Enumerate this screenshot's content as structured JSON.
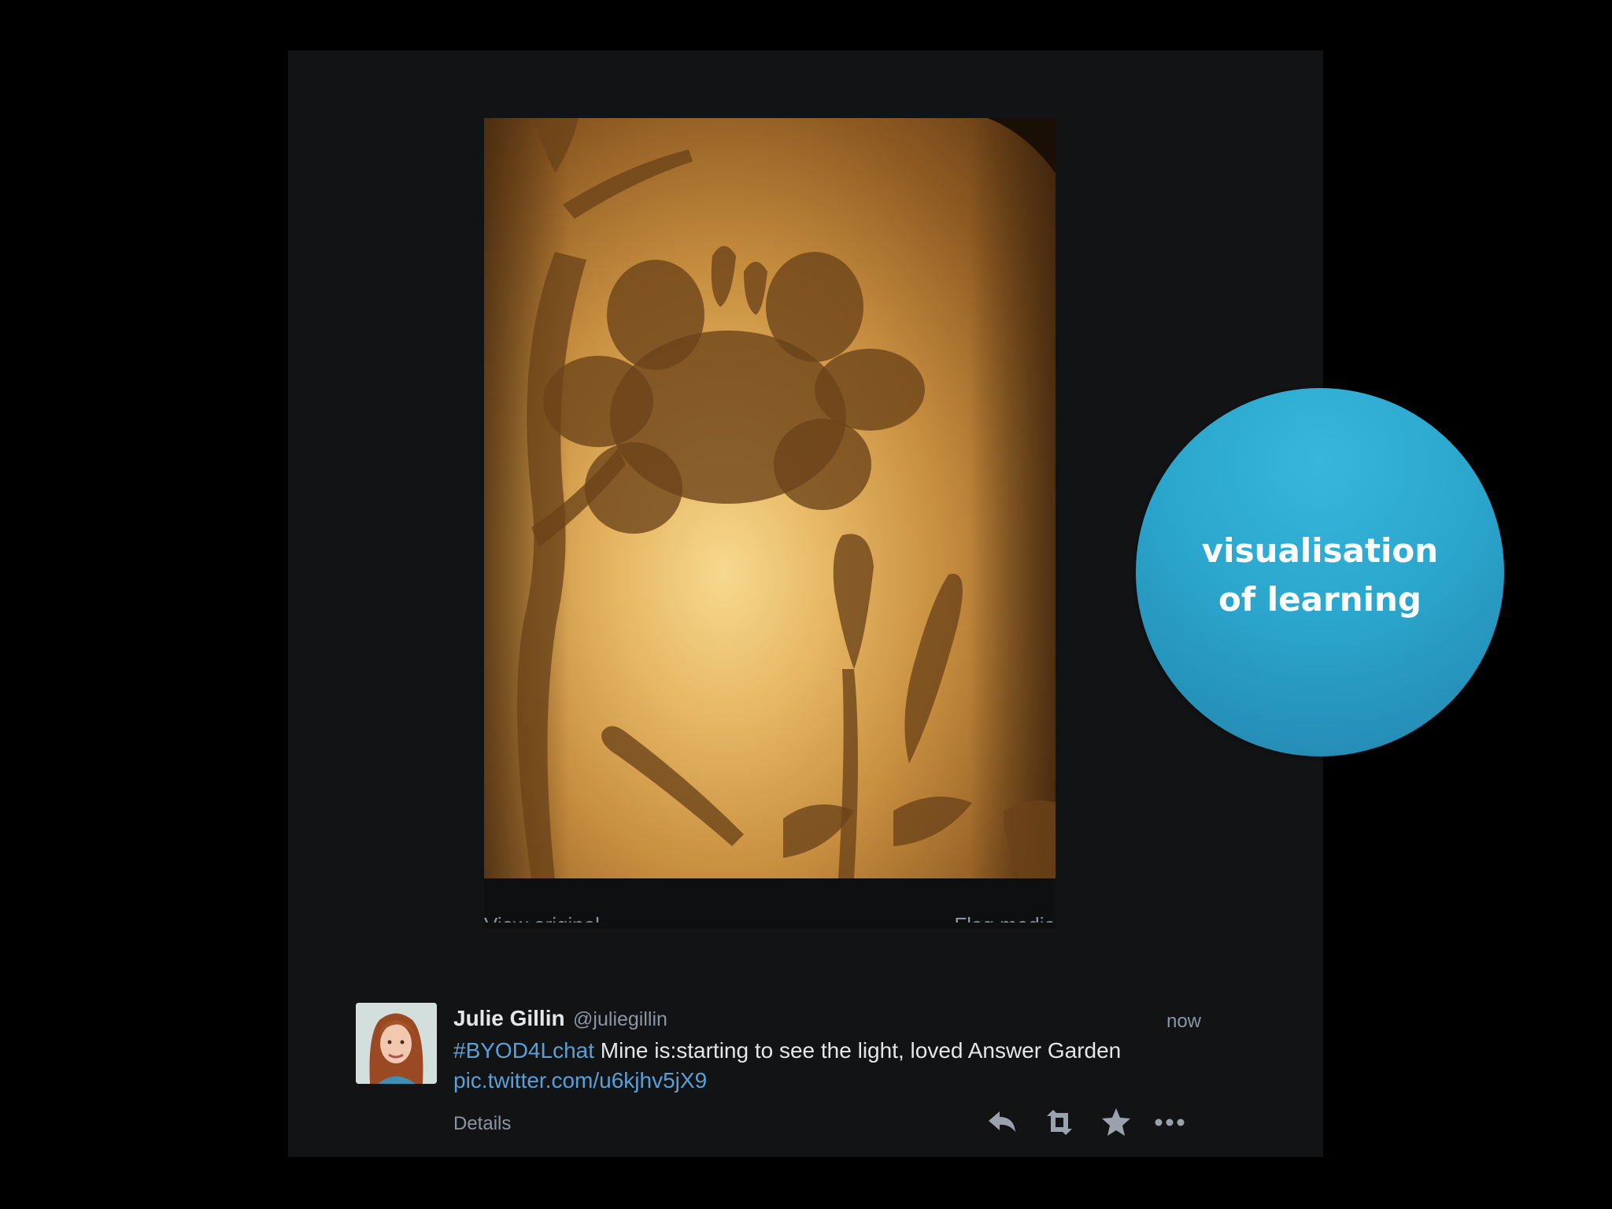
{
  "media": {
    "view_original": "View original",
    "flag_media": "Flag media"
  },
  "tweet": {
    "fullname": "Julie Gillin",
    "username": "@juliegillin",
    "timestamp": "now",
    "hashtag": "#BYOD4Lchat",
    "text": " Mine is:starting to see the light, loved Answer Garden",
    "pic_link": "pic.twitter.com/u6kjhv5jX9",
    "details": "Details",
    "actions": {
      "reply_icon": "reply-icon",
      "retweet_icon": "retweet-icon",
      "favorite_icon": "star-icon",
      "more_icon": "more-icon"
    }
  },
  "bubble": {
    "line1": "visualisation",
    "line2": "of learning",
    "color": "#2ba6cd"
  }
}
